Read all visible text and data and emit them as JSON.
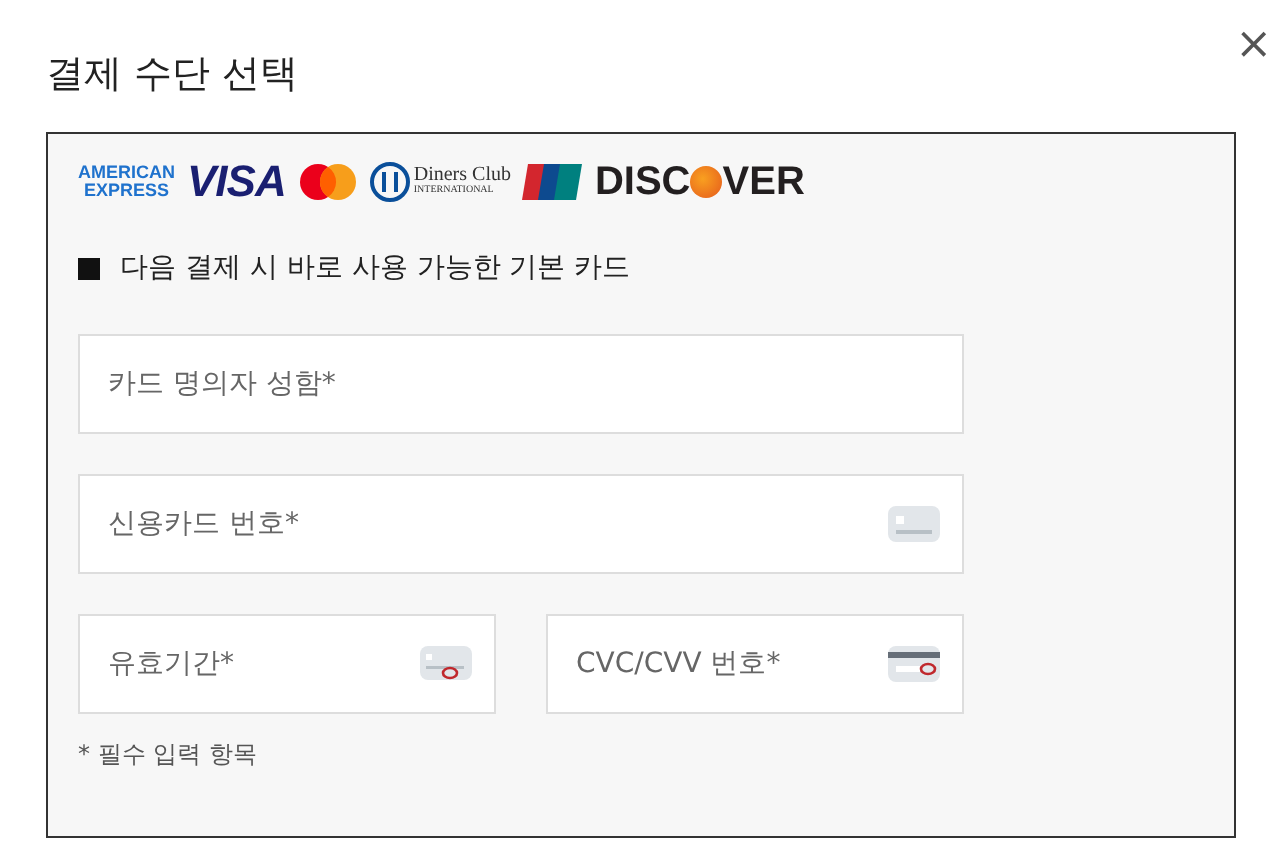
{
  "dialog": {
    "title": "결제 수단 선택",
    "close": "×"
  },
  "card_logos": [
    {
      "kind": "amex",
      "lines": [
        "AMERICAN",
        "EXPRESS"
      ]
    },
    {
      "kind": "visa",
      "lines": [
        "VISA"
      ]
    },
    {
      "kind": "mastercard"
    },
    {
      "kind": "diners",
      "lines": [
        "Diners Club",
        "INTERNATIONAL"
      ]
    },
    {
      "kind": "unionpay"
    },
    {
      "kind": "discover",
      "lines": [
        "DISC",
        "VER"
      ]
    }
  ],
  "default_card": {
    "label": "다음 결제 시 바로 사용 가능한 기본 카드",
    "checked": true
  },
  "fields": [
    {
      "placeholder": "카드 명의자 성함*",
      "kind": "name"
    },
    {
      "placeholder": "신용카드 번호*",
      "kind": "number"
    },
    {
      "placeholder": "유효기간*",
      "kind": "expiry"
    },
    {
      "placeholder": "CVC/CVV 번호*",
      "kind": "cvc"
    }
  ],
  "note": "* 필수 입력 항목"
}
